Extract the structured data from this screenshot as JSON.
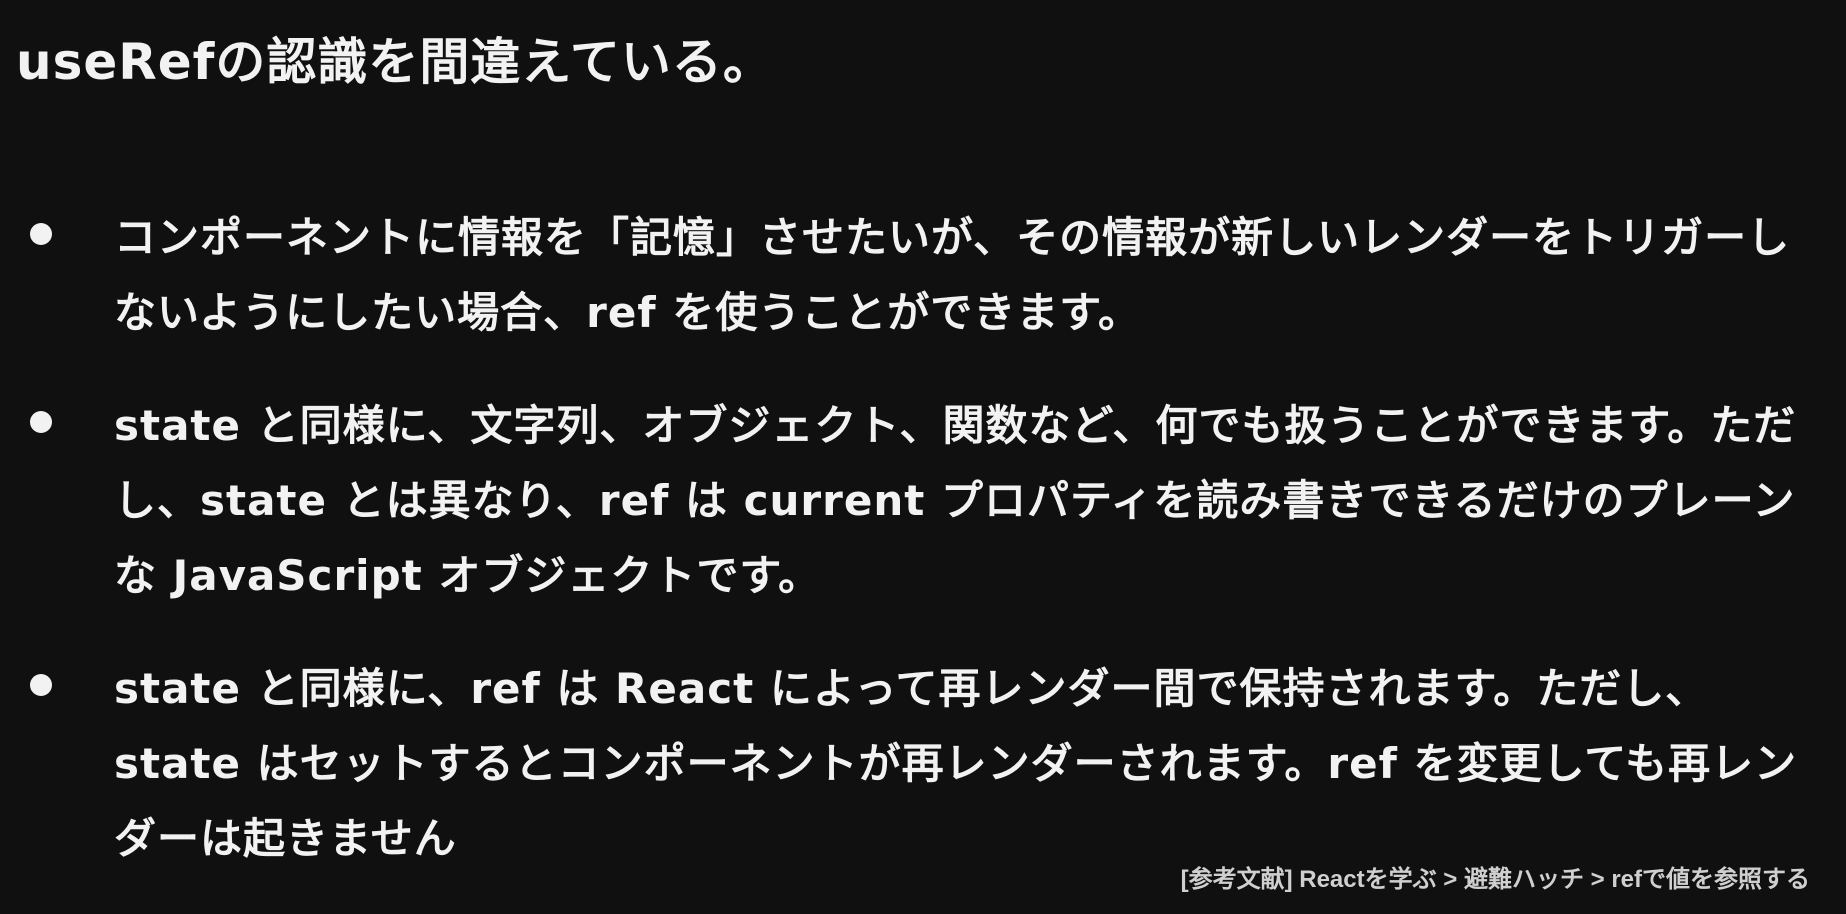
{
  "slide": {
    "title": "useRefの認識を間違えている。",
    "bullets": [
      {
        "text": "コンポーネントに情報を「記憶」させたいが、その情報が新しいレンダーをトリガーしないようにしたい場合、ref を使うことができます。"
      },
      {
        "text": "state と同様に、文字列、オブジェクト、関数など、何でも扱うことができます。ただし、state とは異なり、ref は current プロパティを読み書きできるだけのプレーンな JavaScript オブジェクトです。"
      },
      {
        "text": "state と同様に、ref は React によって再レンダー間で保持されます。ただし、state はセットするとコンポーネントが再レンダーされます。ref を変更しても再レンダーは起きません"
      }
    ],
    "footnote": "[参考文献] Reactを学ぶ > 避難ハッチ > refで値を参照する"
  }
}
